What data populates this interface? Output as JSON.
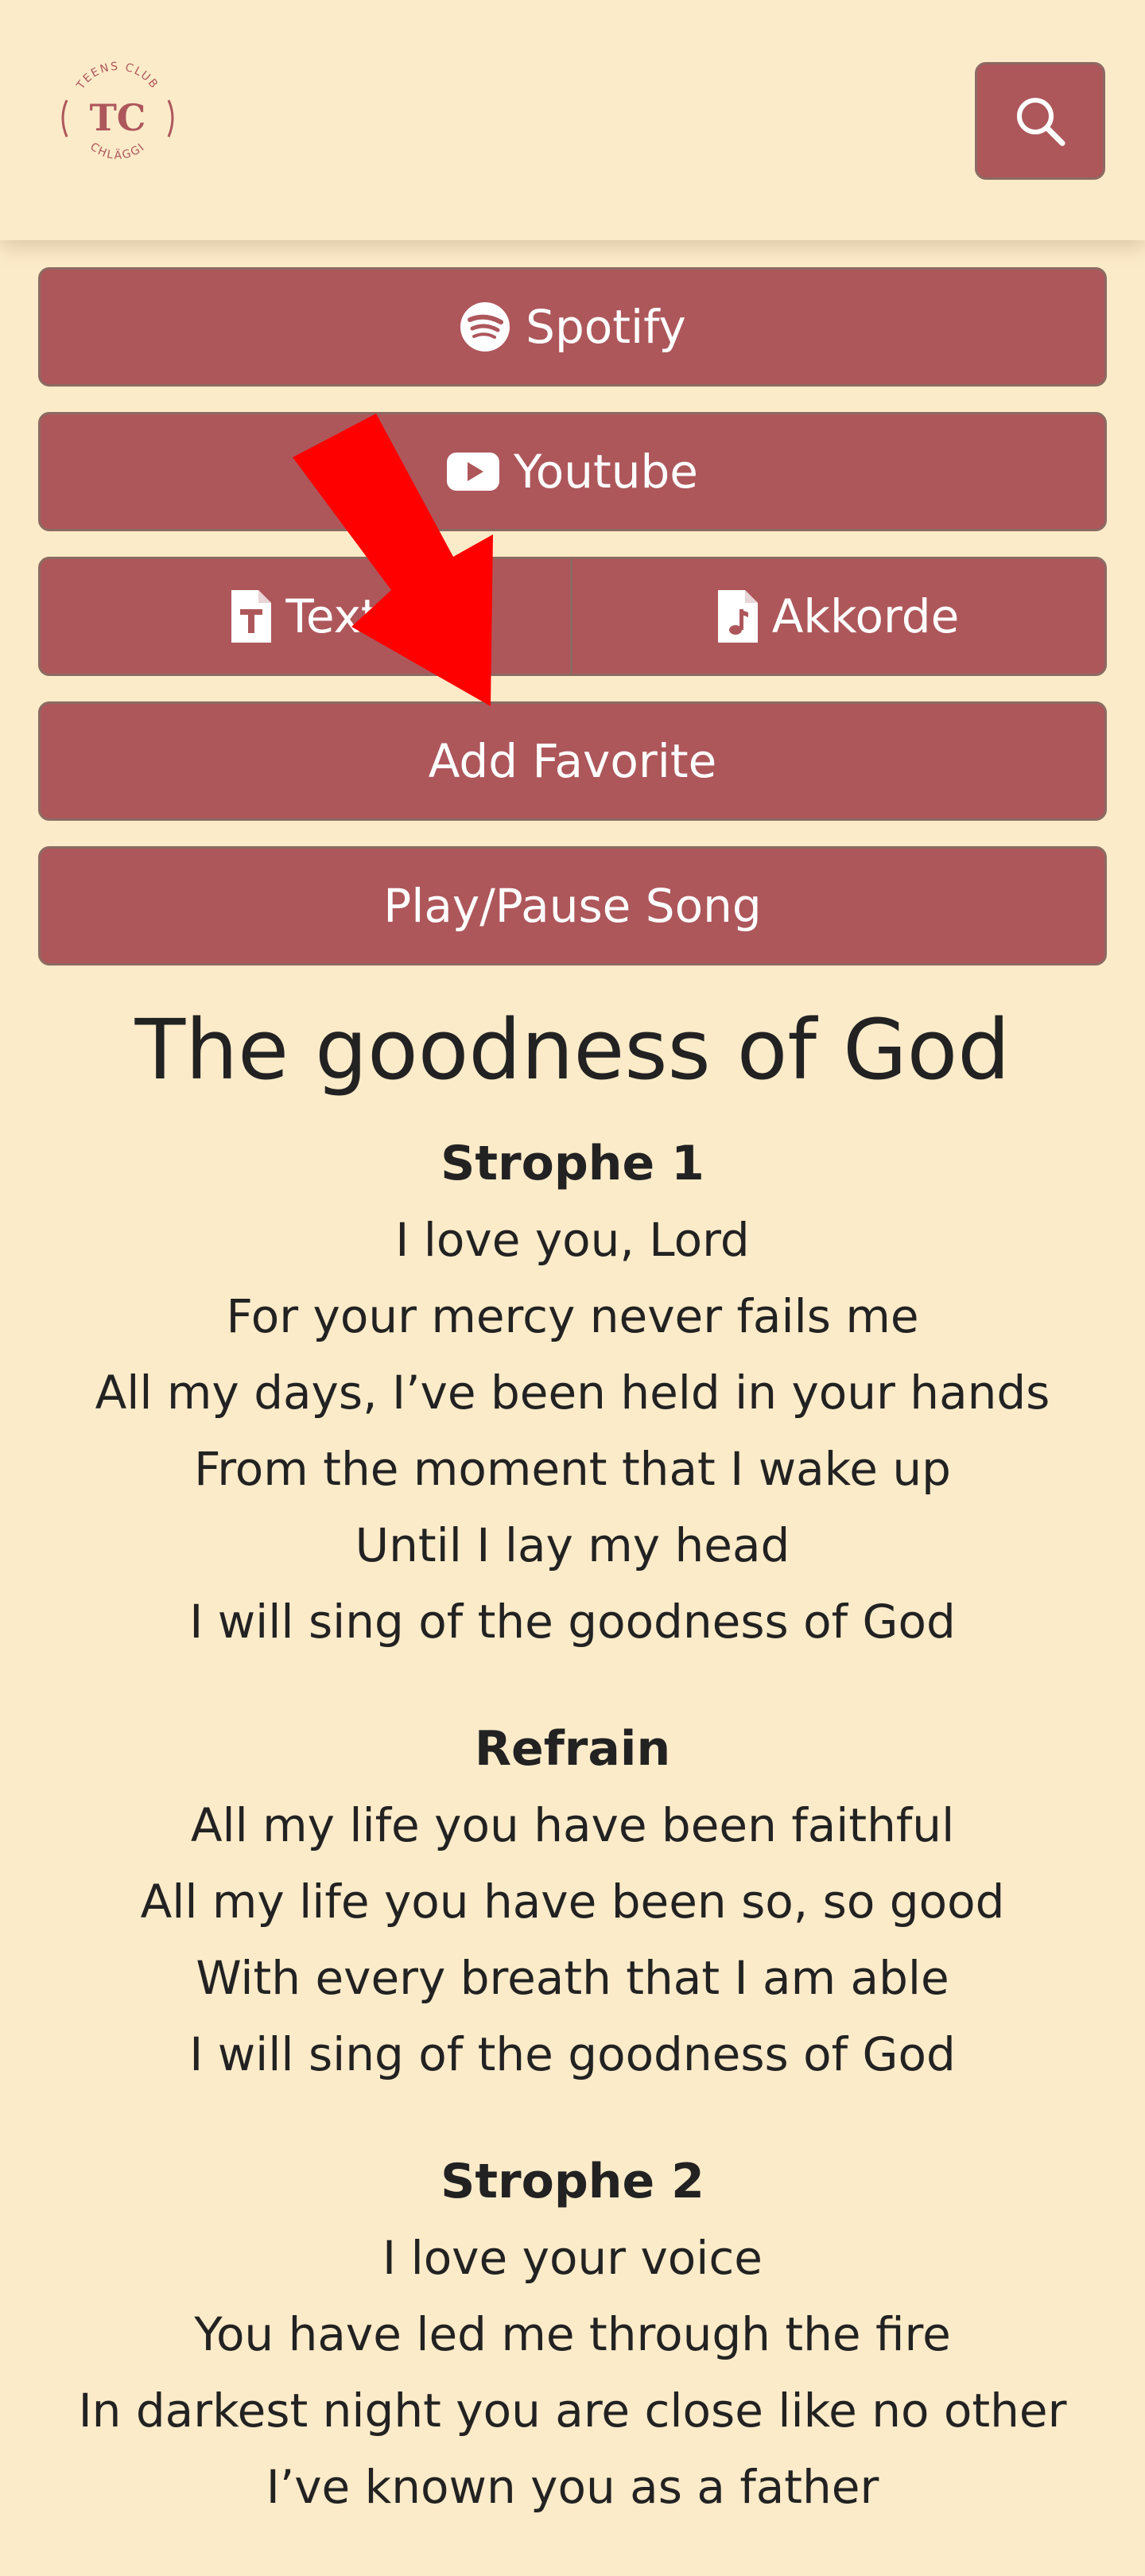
{
  "logo": {
    "top_text": "TEENS CLUB",
    "monogram": "TC",
    "bottom_text": "CHLÄGGI"
  },
  "icons": {
    "search": "search-icon",
    "spotify": "spotify-icon",
    "youtube": "youtube-icon",
    "text": "text-file-icon",
    "chords": "music-file-icon"
  },
  "colors": {
    "background": "#fcebc9",
    "button": "#ad575b",
    "annotation_arrow": "#ff0000"
  },
  "buttons": {
    "spotify": "Spotify",
    "youtube": "Youtube",
    "text": "Text",
    "chords": "Akkorde",
    "favorite": "Add Favorite",
    "play": "Play/Pause Song"
  },
  "song": {
    "title": "The goodness of God",
    "sections": [
      {
        "title": "Strophe 1",
        "lines": [
          "I love you, Lord",
          "For your mercy never fails me",
          "All my days, I’ve been held in your hands",
          "From the moment that I wake up",
          "Until I lay my head",
          "I will sing of the goodness of God"
        ]
      },
      {
        "title": "Refrain",
        "lines": [
          "All my life you have been faithful",
          "All my life you have been so, so good",
          "With every breath that I am able",
          "I will sing of the goodness of God"
        ]
      },
      {
        "title": "Strophe 2",
        "lines": [
          "I love your voice",
          "You have led me through the fire",
          "In darkest night you are close like no other",
          "I’ve known you as a father"
        ]
      }
    ]
  }
}
